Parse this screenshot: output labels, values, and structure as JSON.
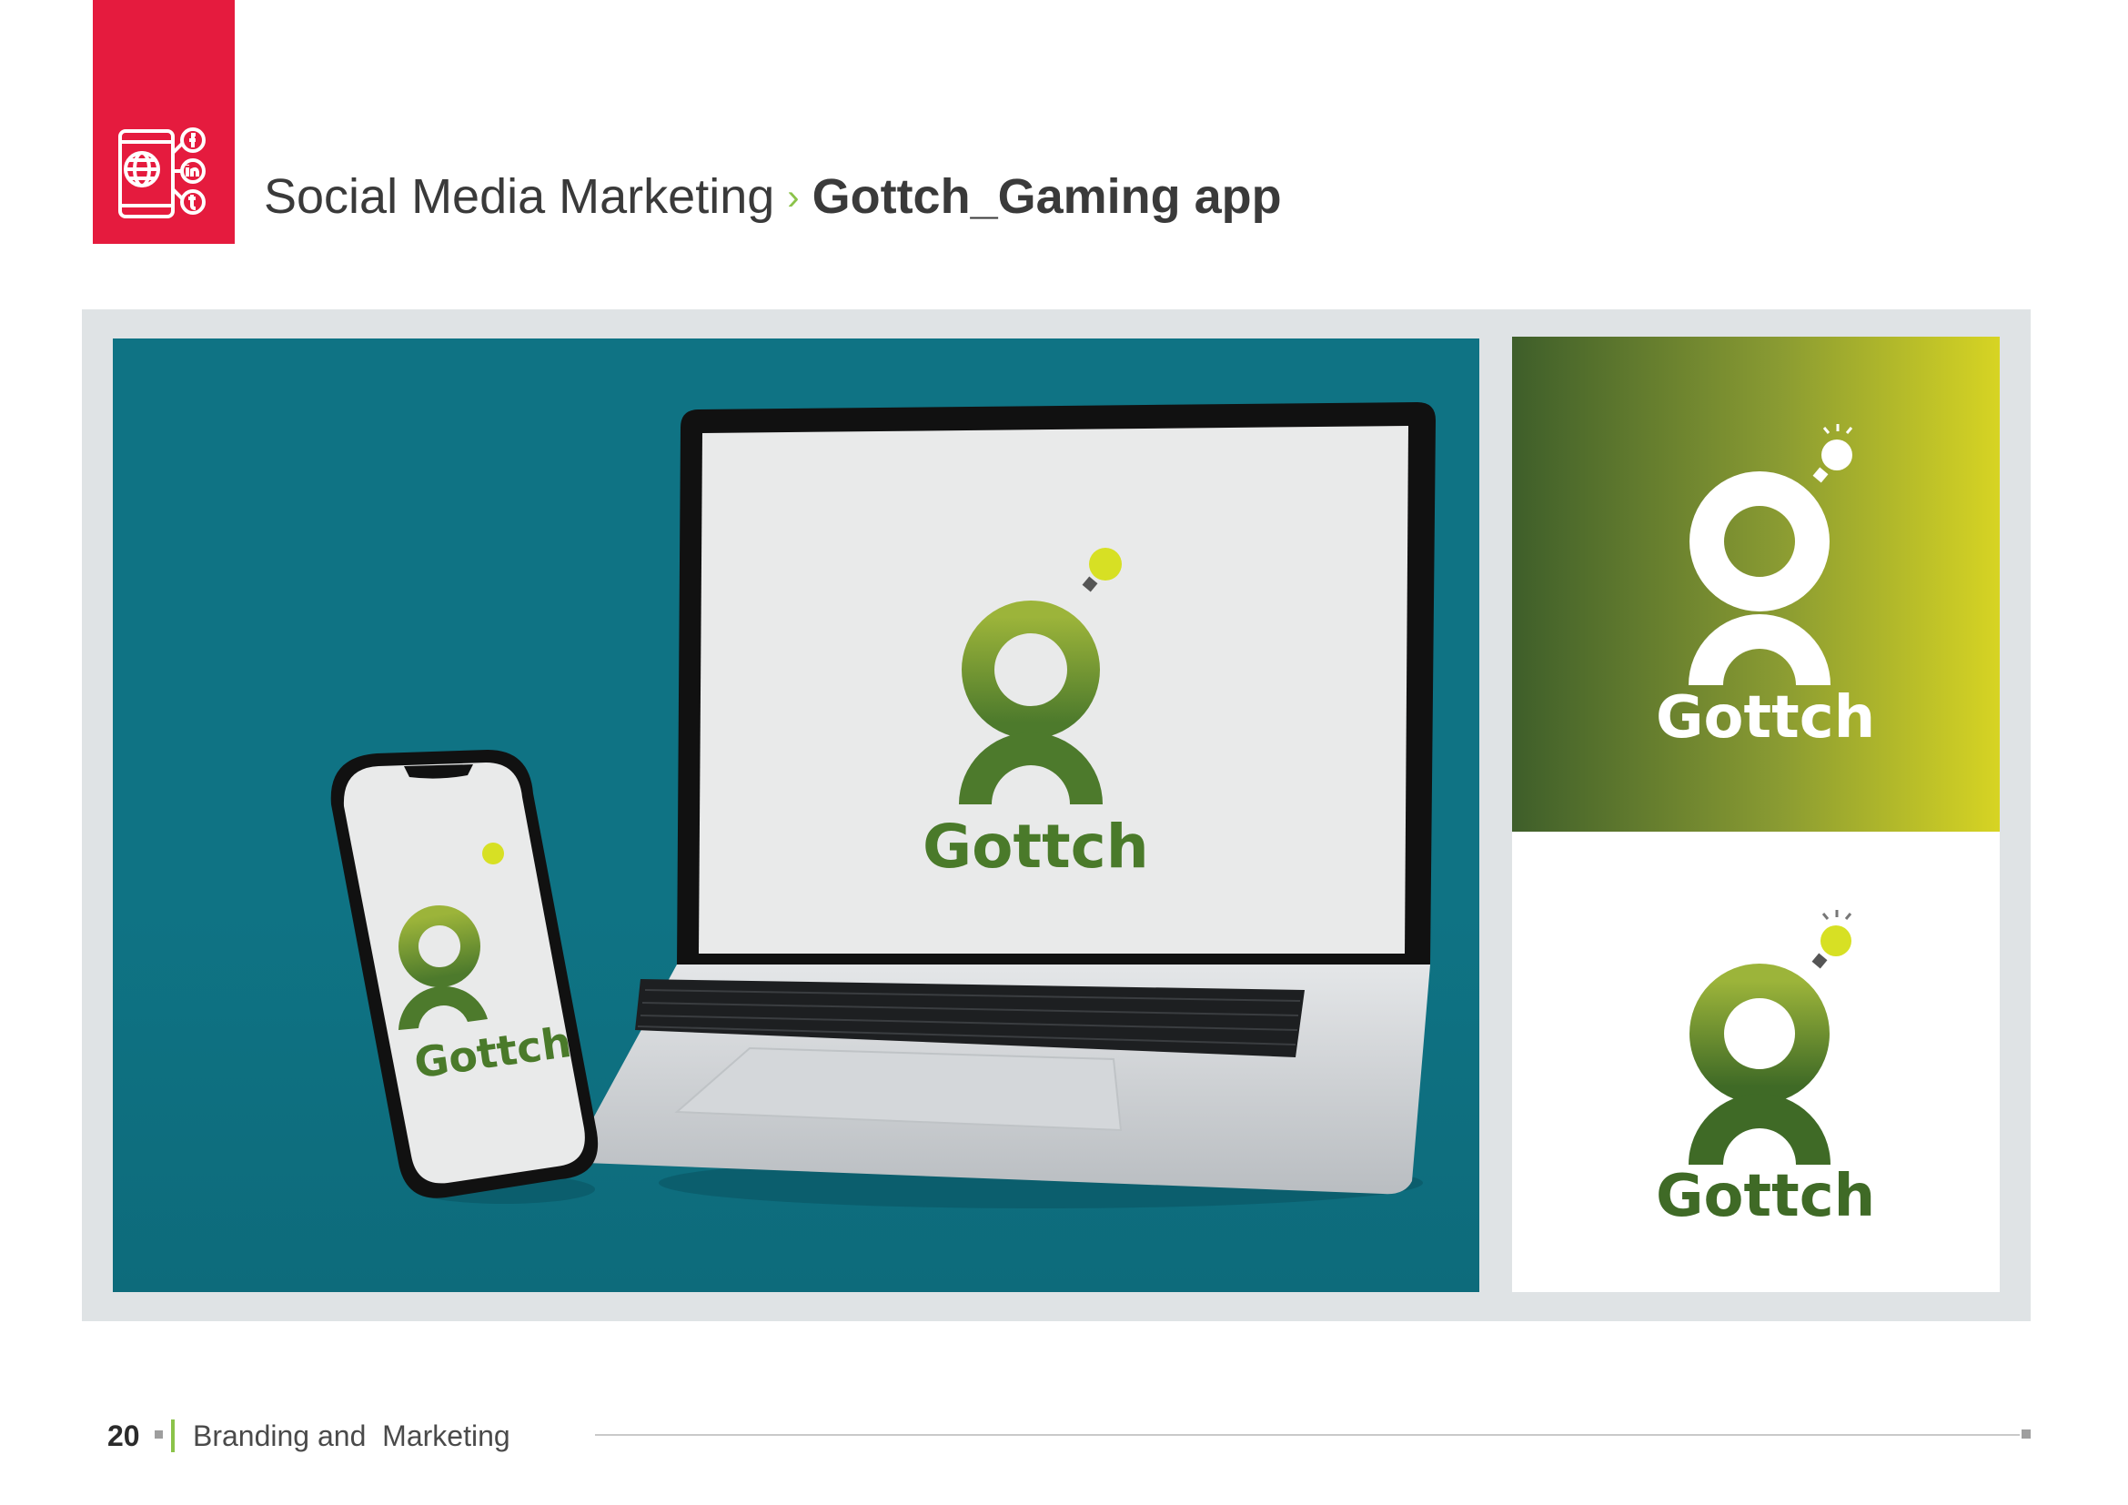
{
  "header": {
    "section": "Social Media Marketing",
    "separator": "›",
    "page_title": "Gottch_Gaming app"
  },
  "brand": {
    "name": "Gottch",
    "colors": {
      "accent_red": "#e51b3e",
      "teal_background": "#0f7384",
      "green_dark": "#3e5e2a",
      "green_light": "#d7d423",
      "divider_green": "#8bc34a"
    },
    "icons": [
      "social-media-device-icon",
      "lightbulb-icon"
    ]
  },
  "footer": {
    "page_number": "20",
    "section": "Branding and  Marketing"
  }
}
